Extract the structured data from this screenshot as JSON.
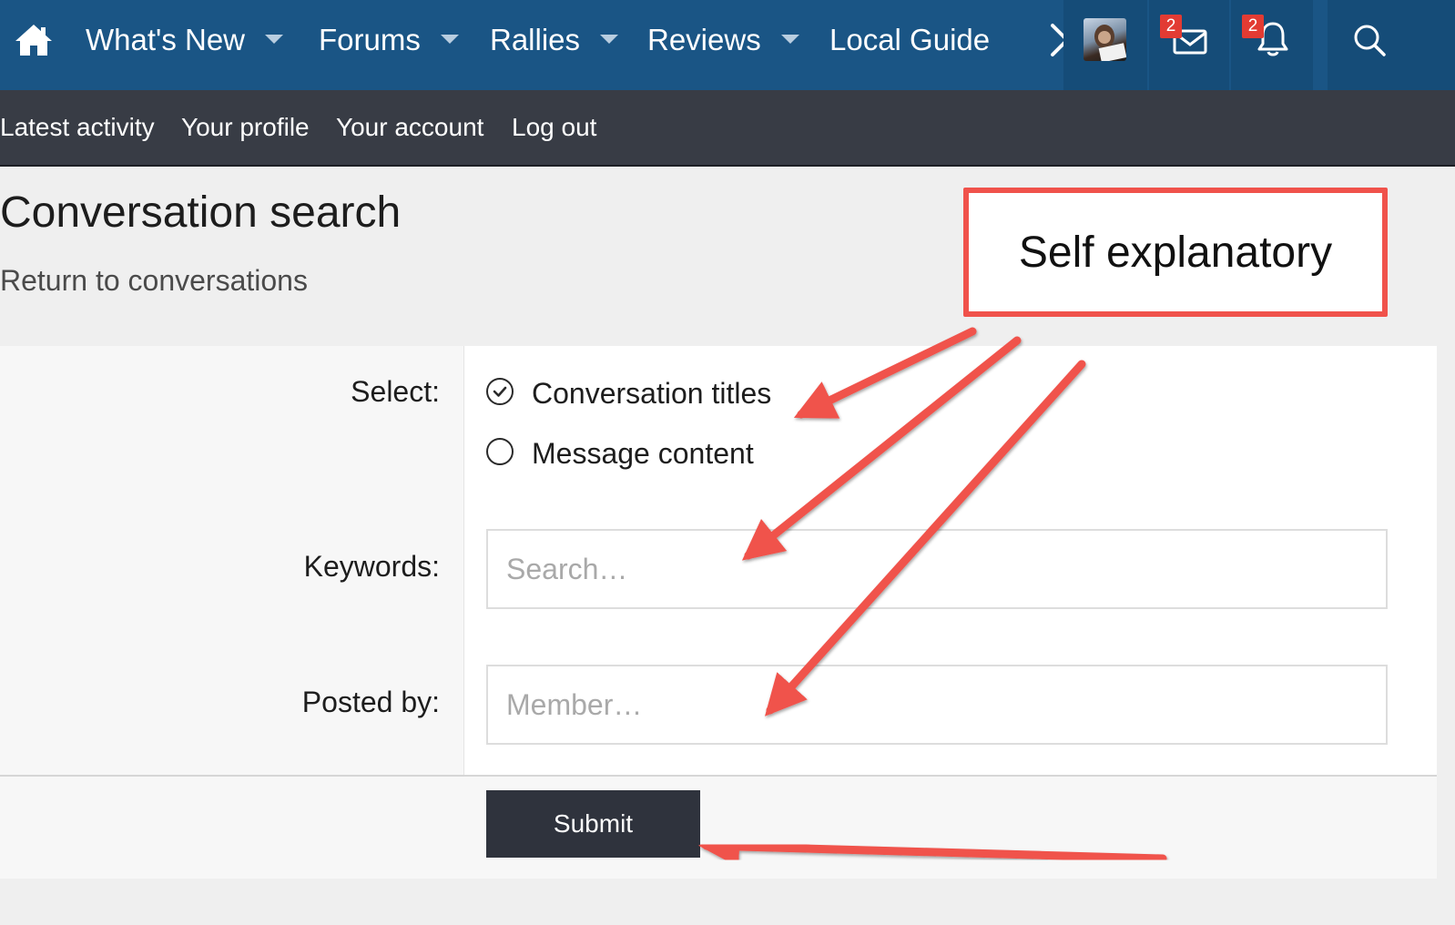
{
  "top_nav": {
    "items": [
      {
        "label": "What's New"
      },
      {
        "label": "Forums"
      },
      {
        "label": "Rallies"
      },
      {
        "label": "Reviews"
      },
      {
        "label": "Local Guide"
      }
    ],
    "inbox_badge": "2",
    "alerts_badge": "2",
    "bar_color": "#1a5585"
  },
  "sub_nav": {
    "items": [
      {
        "label": "Latest activity"
      },
      {
        "label": "Your profile"
      },
      {
        "label": "Your account"
      },
      {
        "label": "Log out"
      }
    ]
  },
  "page": {
    "title": "Conversation search",
    "return_link": "Return to conversations"
  },
  "form": {
    "select_label": "Select:",
    "options": [
      {
        "label": "Conversation titles",
        "selected": true
      },
      {
        "label": "Message content",
        "selected": false
      }
    ],
    "keywords_label": "Keywords:",
    "keywords_placeholder": "Search…",
    "posted_by_label": "Posted by:",
    "posted_by_placeholder": "Member…",
    "submit_label": "Submit"
  },
  "annotation": {
    "callout_text": "Self explanatory",
    "arrow_color": "#f0524b"
  },
  "icons": {
    "home": "home-icon",
    "more": "chevron-right-icon",
    "inbox": "envelope-icon",
    "alerts": "bell-icon",
    "search": "search-icon",
    "checked": "check-circle-icon",
    "unchecked": "radio-empty-icon"
  }
}
